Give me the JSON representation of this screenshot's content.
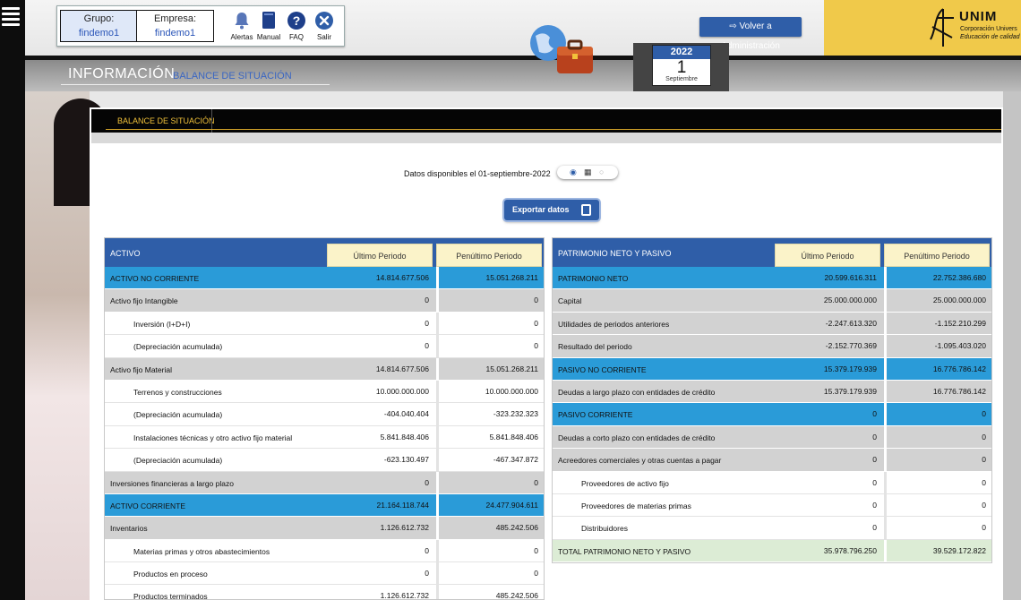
{
  "header": {
    "grupo_label": "Grupo:",
    "grupo_value": "findemo1",
    "empresa_label": "Empresa:",
    "empresa_value": "findemo1",
    "tools": {
      "alertas": "Alertas",
      "manual": "Manual",
      "faq": "FAQ",
      "salir": "Salir"
    },
    "volver_button": "Volver a Administración",
    "logo": {
      "name": "UNIM",
      "line1": "Corporación Univers",
      "line2": "Educación de calidad"
    }
  },
  "title_band": {
    "main": "INFORMACIÓN",
    "sub": "BALANCE DE SITUACIÓN"
  },
  "date_widget": {
    "year": "2022",
    "day": "1",
    "month": "Septiembre"
  },
  "card": {
    "title": "BALANCE DE SITUACIÓN",
    "availability": "Datos disponibles el 01-septiembre-2022",
    "export_button": "Exportar datos"
  },
  "activo_table": {
    "title": "ACTIVO",
    "col1": "Último Periodo",
    "col2": "Penúltimo Periodo",
    "rows": [
      {
        "label": "ACTIVO NO CORRIENTE",
        "v1": "14.814.677.506",
        "v2": "15.051.268.211",
        "style": "blue"
      },
      {
        "label": "Activo fijo Intangible",
        "v1": "0",
        "v2": "0",
        "style": "gray"
      },
      {
        "label": "Inversión (I+D+I)",
        "v1": "0",
        "v2": "0",
        "style": "white",
        "indent": true
      },
      {
        "label": "(Depreciación acumulada)",
        "v1": "0",
        "v2": "0",
        "style": "white",
        "indent": true
      },
      {
        "label": "Activo fijo Material",
        "v1": "14.814.677.506",
        "v2": "15.051.268.211",
        "style": "gray"
      },
      {
        "label": "Terrenos y construcciones",
        "v1": "10.000.000.000",
        "v2": "10.000.000.000",
        "style": "white",
        "indent": true
      },
      {
        "label": "(Depreciación acumulada)",
        "v1": "-404.040.404",
        "v2": "-323.232.323",
        "style": "white",
        "indent": true
      },
      {
        "label": "Instalaciones técnicas y otro activo fijo material",
        "v1": "5.841.848.406",
        "v2": "5.841.848.406",
        "style": "white",
        "indent": true
      },
      {
        "label": "(Depreciación acumulada)",
        "v1": "-623.130.497",
        "v2": "-467.347.872",
        "style": "white",
        "indent": true
      },
      {
        "label": "Inversiones financieras a largo plazo",
        "v1": "0",
        "v2": "0",
        "style": "gray"
      },
      {
        "label": "ACTIVO CORRIENTE",
        "v1": "21.164.118.744",
        "v2": "24.477.904.611",
        "style": "blue"
      },
      {
        "label": "Inventarios",
        "v1": "1.126.612.732",
        "v2": "485.242.506",
        "style": "gray"
      },
      {
        "label": "Materias primas y otros abastecimientos",
        "v1": "0",
        "v2": "0",
        "style": "white",
        "indent": true
      },
      {
        "label": "Productos en proceso",
        "v1": "0",
        "v2": "0",
        "style": "white",
        "indent": true
      },
      {
        "label": "Productos terminados",
        "v1": "1.126.612.732",
        "v2": "485.242.506",
        "style": "white",
        "indent": true
      }
    ]
  },
  "pasivo_table": {
    "title": "PATRIMONIO NETO Y PASIVO",
    "col1": "Último Periodo",
    "col2": "Penúltimo Periodo",
    "rows": [
      {
        "label": "PATRIMONIO NETO",
        "v1": "20.599.616.311",
        "v2": "22.752.386.680",
        "style": "blue"
      },
      {
        "label": "Capital",
        "v1": "25.000.000.000",
        "v2": "25.000.000.000",
        "style": "gray"
      },
      {
        "label": "Utilidades de periodos anteriores",
        "v1": "-2.247.613.320",
        "v2": "-1.152.210.299",
        "style": "gray"
      },
      {
        "label": "Resultado del periodo",
        "v1": "-2.152.770.369",
        "v2": "-1.095.403.020",
        "style": "gray"
      },
      {
        "label": "PASIVO NO CORRIENTE",
        "v1": "15.379.179.939",
        "v2": "16.776.786.142",
        "style": "blue"
      },
      {
        "label": "Deudas a largo plazo con entidades de crédito",
        "v1": "15.379.179.939",
        "v2": "16.776.786.142",
        "style": "gray"
      },
      {
        "label": "PASIVO CORRIENTE",
        "v1": "0",
        "v2": "0",
        "style": "blue"
      },
      {
        "label": "Deudas a corto plazo con entidades de crédito",
        "v1": "0",
        "v2": "0",
        "style": "gray"
      },
      {
        "label": "Acreedores comerciales y otras cuentas a pagar",
        "v1": "0",
        "v2": "0",
        "style": "gray"
      },
      {
        "label": "Proveedores de activo fijo",
        "v1": "0",
        "v2": "0",
        "style": "white",
        "indent": true
      },
      {
        "label": "Proveedores de materias primas",
        "v1": "0",
        "v2": "0",
        "style": "white",
        "indent": true
      },
      {
        "label": "Distribuidores",
        "v1": "0",
        "v2": "0",
        "style": "white",
        "indent": true
      },
      {
        "label": "TOTAL PATRIMONIO NETO Y PASIVO",
        "v1": "35.978.796.250",
        "v2": "39.529.172.822",
        "style": "green"
      }
    ]
  },
  "colors": {
    "primary_blue": "#2f5ea8",
    "row_blue": "#2a9bd8",
    "gold": "#f2c23a",
    "header_col": "#fbf3c9"
  }
}
